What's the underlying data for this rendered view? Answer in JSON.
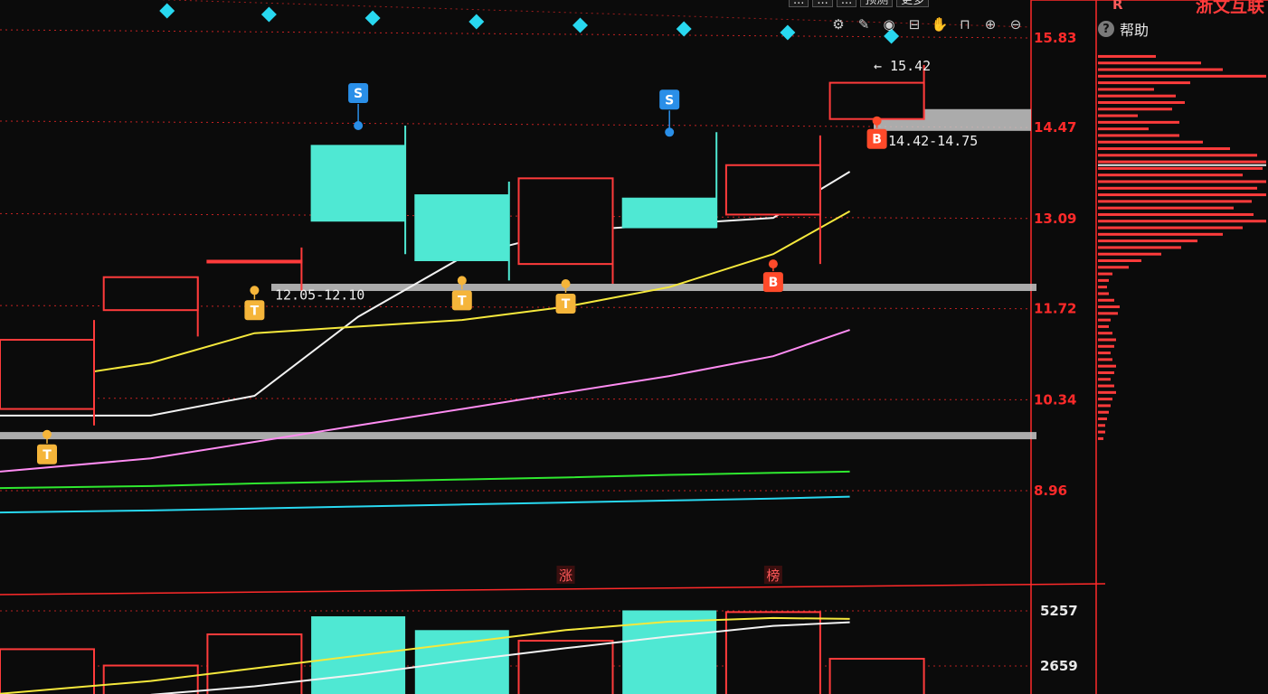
{
  "colors": {
    "up": "#ff3b3b",
    "down": "#4fe8d3",
    "axis": "#ff2a2a",
    "ma5": "#f2f2f2",
    "ma10": "#f5e83c",
    "ma20": "#ff8cf2",
    "ma60": "#2fe82f",
    "ma120": "#28d8f0",
    "zone": "#c8c8c8",
    "signal_t": "#f5b53a",
    "signal_s": "#2a8fe8",
    "signal_b": "#ff4a2a"
  },
  "header": {
    "menu_labels": [
      "...",
      "...",
      "...",
      "预测",
      "更多"
    ],
    "r_label": "R",
    "stock_name": "浙文互联",
    "help_label": "帮助"
  },
  "toolbar": {
    "icons": [
      "settings-icon",
      "pen-icon",
      "eye-icon",
      "basket-icon",
      "hand-icon",
      "lock-icon",
      "zoom-in-icon",
      "zoom-out-icon"
    ]
  },
  "chart_data": {
    "type": "candlestick",
    "price_axis": {
      "ticks": [
        "15.83",
        "14.47",
        "13.09",
        "11.72",
        "10.34",
        "8.96"
      ],
      "tick_values": [
        15.83,
        14.47,
        13.09,
        11.72,
        10.34,
        8.96
      ]
    },
    "volume_axis": {
      "ticks": [
        "5257",
        "2659"
      ],
      "tick_values": [
        5257,
        2659
      ]
    },
    "candles": [
      {
        "o": 10.2,
        "c": 11.25,
        "h": 11.55,
        "l": 9.95,
        "dir": "up"
      },
      {
        "o": 11.7,
        "c": 12.2,
        "h": 12.2,
        "l": 11.3,
        "dir": "up"
      },
      {
        "o": 12.45,
        "c": 12.45,
        "h": 12.65,
        "l": 12.0,
        "dir": "up"
      },
      {
        "o": 14.2,
        "c": 13.05,
        "h": 14.5,
        "l": 12.55,
        "dir": "down"
      },
      {
        "o": 13.45,
        "c": 12.45,
        "h": 13.65,
        "l": 12.15,
        "dir": "down"
      },
      {
        "o": 12.4,
        "c": 13.7,
        "h": 13.7,
        "l": 12.1,
        "dir": "up"
      },
      {
        "o": 13.4,
        "c": 12.95,
        "h": 14.4,
        "l": 12.95,
        "dir": "down"
      },
      {
        "o": 13.15,
        "c": 13.9,
        "h": 14.35,
        "l": 12.4,
        "dir": "up"
      },
      {
        "o": 14.6,
        "c": 15.15,
        "h": 15.42,
        "l": 14.6,
        "dir": "up"
      }
    ],
    "ma_series": [
      {
        "key": "ma5",
        "values": [
          10.1,
          10.1,
          10.4,
          11.6,
          12.5,
          12.9,
          13.0,
          13.1,
          13.8
        ]
      },
      {
        "key": "ma10",
        "values": [
          10.55,
          10.9,
          11.35,
          11.45,
          11.55,
          11.75,
          12.05,
          12.55,
          13.2
        ]
      },
      {
        "key": "ma20",
        "values": [
          9.25,
          9.45,
          9.7,
          9.95,
          10.2,
          10.45,
          10.7,
          11.0,
          11.4
        ]
      },
      {
        "key": "ma60",
        "values": [
          9.0,
          9.03,
          9.07,
          9.1,
          9.13,
          9.16,
          9.2,
          9.23,
          9.25
        ]
      },
      {
        "key": "ma120",
        "values": [
          8.63,
          8.66,
          8.69,
          8.72,
          8.75,
          8.78,
          8.81,
          8.84,
          8.87
        ]
      }
    ],
    "zones": [
      {
        "low": 14.42,
        "high": 14.75,
        "label": "14.42-14.75"
      },
      {
        "low": 12.05,
        "high": 12.1,
        "label": "12.05-12.10"
      },
      {
        "low": 9.75,
        "high": 9.85,
        "label": ""
      }
    ],
    "dotted_levels": [
      15.83,
      14.47,
      13.09,
      11.72,
      10.34,
      8.96
    ],
    "signals": [
      {
        "candle": 0,
        "type": "T",
        "label": "T"
      },
      {
        "candle": 2,
        "type": "T",
        "label": "T"
      },
      {
        "candle": 3,
        "type": "S",
        "label": "S"
      },
      {
        "candle": 4,
        "type": "T",
        "label": "T"
      },
      {
        "candle": 5,
        "type": "T",
        "label": "T"
      },
      {
        "candle": 6,
        "type": "S",
        "label": "S"
      },
      {
        "candle": 7,
        "type": "B",
        "label": "B"
      },
      {
        "candle": 8,
        "type": "B",
        "label": "B"
      }
    ],
    "high_marker": {
      "value": 15.42,
      "label": "← 15.42"
    },
    "event_tags": [
      {
        "candle": 5,
        "label": "涨"
      },
      {
        "candle": 7,
        "label": "榜"
      }
    ],
    "volume": [
      {
        "value": 3450,
        "dir": "up"
      },
      {
        "value": 2680,
        "dir": "up"
      },
      {
        "value": 4150,
        "dir": "up"
      },
      {
        "value": 5000,
        "dir": "down"
      },
      {
        "value": 4350,
        "dir": "down"
      },
      {
        "value": 3850,
        "dir": "up"
      },
      {
        "value": 5280,
        "dir": "down"
      },
      {
        "value": 5200,
        "dir": "up"
      },
      {
        "value": 3000,
        "dir": "up"
      }
    ],
    "vol_ma": [
      {
        "key": "ma10",
        "values": [
          1350,
          1950,
          2550,
          3150,
          3750,
          4350,
          4750,
          4920,
          4880
        ]
      },
      {
        "key": "ma5",
        "values": [
          900,
          1300,
          1700,
          2250,
          2900,
          3500,
          4050,
          4550,
          4720
        ]
      }
    ],
    "volume_profile": [
      {
        "price": 15.55,
        "w": 64
      },
      {
        "price": 15.45,
        "w": 114
      },
      {
        "price": 15.35,
        "w": 138
      },
      {
        "price": 15.25,
        "w": 188
      },
      {
        "price": 15.15,
        "w": 102
      },
      {
        "price": 15.05,
        "w": 62
      },
      {
        "price": 14.95,
        "w": 86
      },
      {
        "price": 14.85,
        "w": 96
      },
      {
        "price": 14.75,
        "w": 82
      },
      {
        "price": 14.65,
        "w": 44
      },
      {
        "price": 14.55,
        "w": 90
      },
      {
        "price": 14.45,
        "w": 56
      },
      {
        "price": 14.35,
        "w": 90
      },
      {
        "price": 14.25,
        "w": 116
      },
      {
        "price": 14.15,
        "w": 146
      },
      {
        "price": 14.05,
        "w": 176
      },
      {
        "price": 13.95,
        "w": 188
      },
      {
        "price": 13.85,
        "w": 182
      },
      {
        "price": 13.75,
        "w": 160
      },
      {
        "price": 13.65,
        "w": 188
      },
      {
        "price": 13.55,
        "w": 176
      },
      {
        "price": 13.45,
        "w": 188
      },
      {
        "price": 13.35,
        "w": 170
      },
      {
        "price": 13.25,
        "w": 150
      },
      {
        "price": 13.15,
        "w": 172
      },
      {
        "price": 13.05,
        "w": 188
      },
      {
        "price": 12.95,
        "w": 160
      },
      {
        "price": 12.85,
        "w": 138
      },
      {
        "price": 12.75,
        "w": 110
      },
      {
        "price": 12.65,
        "w": 92
      },
      {
        "price": 12.55,
        "w": 70
      },
      {
        "price": 12.45,
        "w": 48
      },
      {
        "price": 12.35,
        "w": 34
      },
      {
        "price": 12.25,
        "w": 16
      },
      {
        "price": 12.15,
        "w": 12
      },
      {
        "price": 12.05,
        "w": 10
      },
      {
        "price": 11.95,
        "w": 12
      },
      {
        "price": 11.85,
        "w": 18
      },
      {
        "price": 11.75,
        "w": 24
      },
      {
        "price": 11.65,
        "w": 22
      },
      {
        "price": 11.55,
        "w": 14
      },
      {
        "price": 11.45,
        "w": 12
      },
      {
        "price": 11.35,
        "w": 16
      },
      {
        "price": 11.25,
        "w": 20
      },
      {
        "price": 11.15,
        "w": 18
      },
      {
        "price": 11.05,
        "w": 14
      },
      {
        "price": 10.95,
        "w": 16
      },
      {
        "price": 10.85,
        "w": 20
      },
      {
        "price": 10.75,
        "w": 18
      },
      {
        "price": 10.65,
        "w": 14
      },
      {
        "price": 10.55,
        "w": 18
      },
      {
        "price": 10.45,
        "w": 20
      },
      {
        "price": 10.35,
        "w": 16
      },
      {
        "price": 10.25,
        "w": 14
      },
      {
        "price": 10.15,
        "w": 12
      },
      {
        "price": 10.05,
        "w": 10
      },
      {
        "price": 9.95,
        "w": 8
      },
      {
        "price": 9.85,
        "w": 8
      },
      {
        "price": 9.75,
        "w": 6
      }
    ]
  }
}
